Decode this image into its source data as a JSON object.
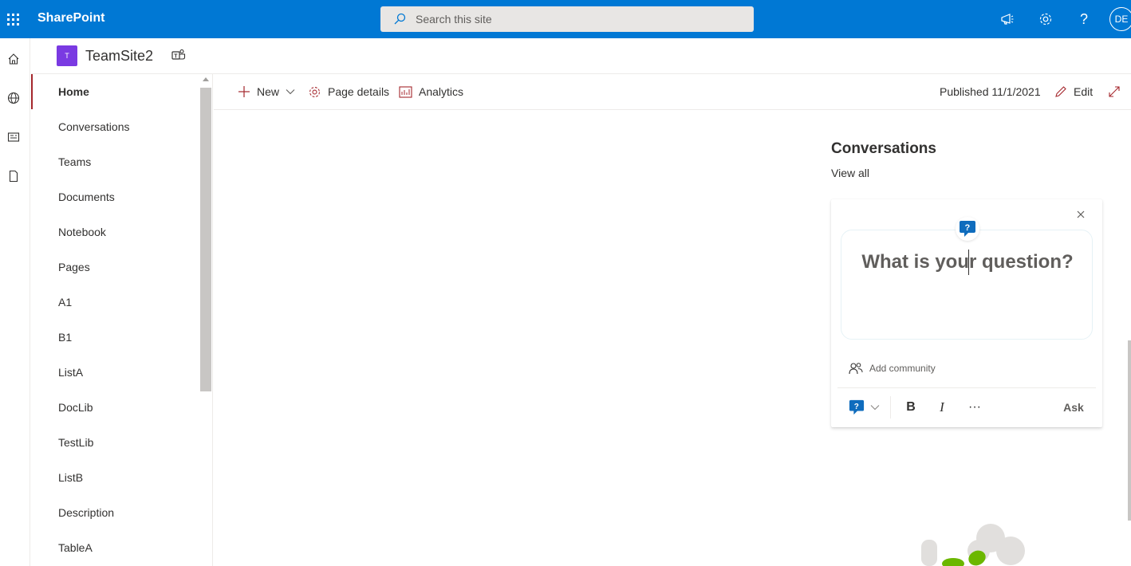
{
  "suite_bar": {
    "app_name": "SharePoint",
    "search_placeholder": "Search this site",
    "avatar_initials": "DE",
    "accent_color": "#0078d4"
  },
  "site": {
    "logo_letter": "T",
    "title": "TeamSite2",
    "logo_color": "#7a3ae2"
  },
  "left_nav": {
    "items": [
      {
        "label": "Home",
        "active": true
      },
      {
        "label": "Conversations"
      },
      {
        "label": "Teams"
      },
      {
        "label": "Documents"
      },
      {
        "label": "Notebook"
      },
      {
        "label": "Pages"
      },
      {
        "label": "A1"
      },
      {
        "label": "B1"
      },
      {
        "label": "ListA"
      },
      {
        "label": "DocLib"
      },
      {
        "label": "TestLib"
      },
      {
        "label": "ListB"
      },
      {
        "label": "Description"
      },
      {
        "label": "TableA"
      }
    ]
  },
  "command_bar": {
    "new_label": "New",
    "page_details_label": "Page details",
    "analytics_label": "Analytics",
    "published_text": "Published 11/1/2021",
    "edit_label": "Edit"
  },
  "conversations": {
    "title": "Conversations",
    "view_all": "View all",
    "question_placeholder": "What is your question?",
    "add_community": "Add community",
    "ask_label": "Ask",
    "bold_label": "B",
    "italic_label": "I",
    "more_label": "···"
  },
  "icons": {
    "waffle": "waffle-icon",
    "search": "search-icon",
    "megaphone": "megaphone-icon",
    "settings": "gear-icon",
    "help": "help-icon",
    "teams": "teams-icon"
  }
}
